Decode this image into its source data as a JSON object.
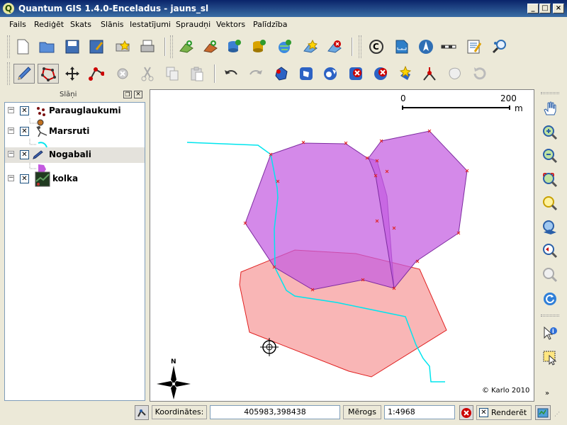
{
  "window": {
    "title": "Quantum GIS 1.4.0-Enceladus - jauns_sl"
  },
  "menu": [
    "Fails",
    "Rediģēt",
    "Skats",
    "Slānis",
    "Iestatījumi",
    "Spraudņi",
    "Vektors",
    "Palīdzība"
  ],
  "layers_panel": {
    "title": "Slāņi",
    "layers": [
      {
        "name": "Parauglaukumi",
        "checked": true,
        "icon": "point-layer-icon"
      },
      {
        "name": "Marsruti",
        "checked": true,
        "icon": "line-layer-icon"
      },
      {
        "name": "Nogabali",
        "checked": true,
        "icon": "polygon-layer-icon"
      },
      {
        "name": "kolka",
        "checked": true,
        "icon": "raster-layer-icon"
      }
    ]
  },
  "map": {
    "scalebar": {
      "start": "0",
      "end": "200",
      "unit": "m"
    },
    "north_label": "N",
    "copyright": "© Karlo 2010",
    "colors": {
      "purple": "#c45be0",
      "pink": "#f79a9a",
      "route": "#00e5ee"
    }
  },
  "status": {
    "coords_label": "Koordinātes:",
    "coords_value": "405983,398438",
    "scale_label": "Mērogs",
    "scale_value": "1:4968",
    "render_label": "Renderēt",
    "render_checked": true
  }
}
